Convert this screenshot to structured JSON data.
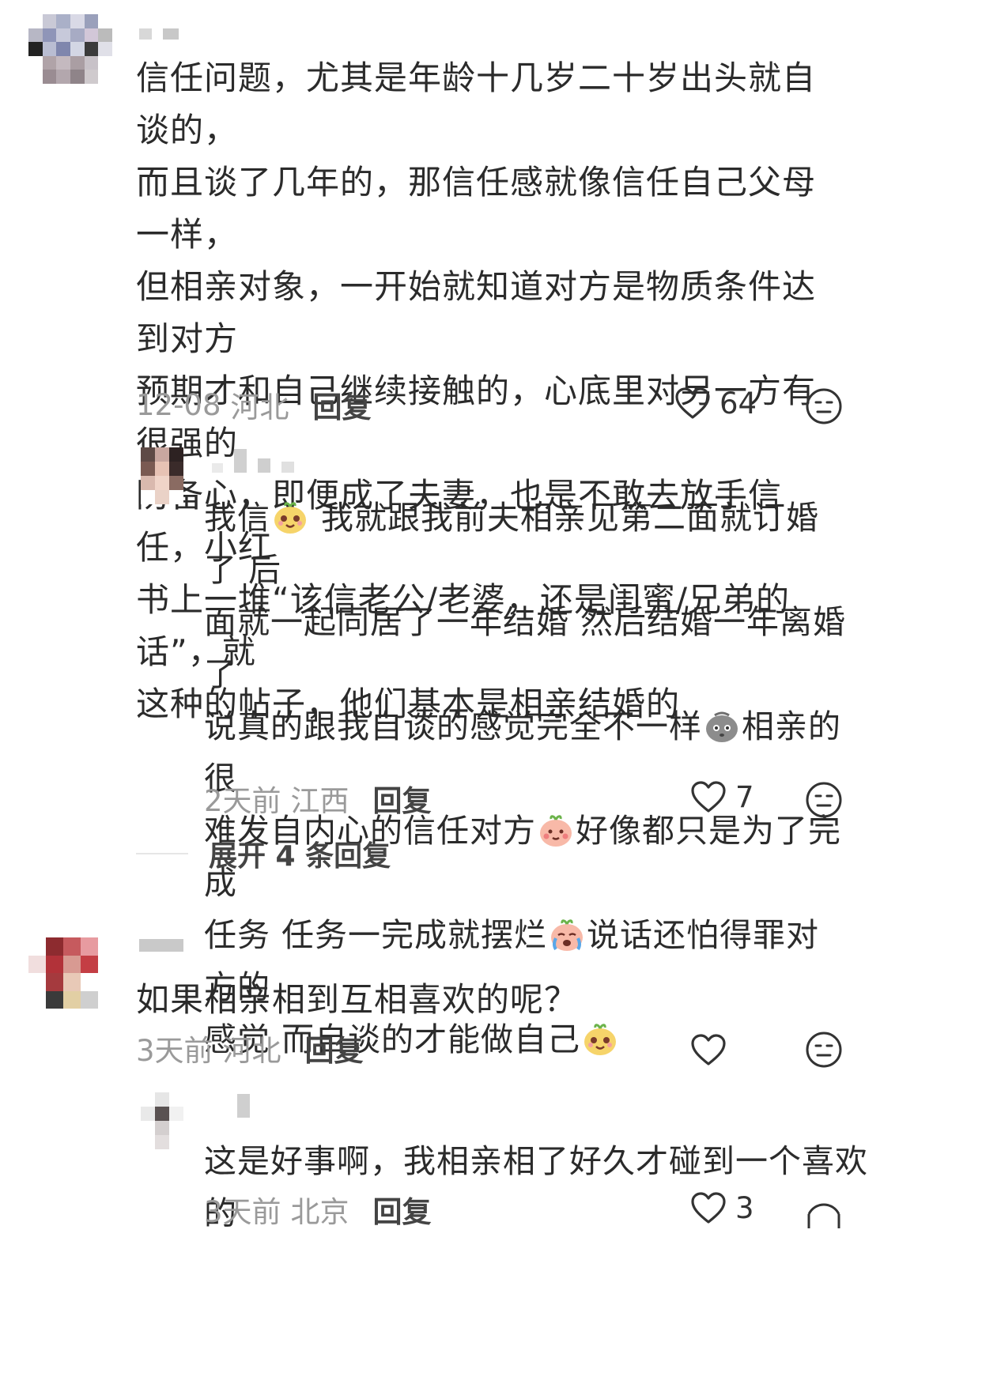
{
  "comments": [
    {
      "text": "信任问题，尤其是年龄十几岁二十岁出头就自谈的，而且谈了几年的，那信任感就像信任自己父母一样，但相亲对象，一开始就知道对方是物质条件达到对方预期才和自己继续接触的，心底里对另一方有很强的防备心，即便成了夫妻，也是不敢去放手信任，小红书上一堆“该信老公/老婆，还是闺蜜/兄弟的话”，就这种的帖子，他们基本是相亲结婚的",
      "lines": [
        "信任问题，尤其是年龄十几岁二十岁出头就自谈的，",
        "而且谈了几年的，那信任感就像信任自己父母一样，",
        "但相亲对象，一开始就知道对方是物质条件达到对方",
        "预期才和自己继续接触的，心底里对另一方有很强的",
        "防备心，即便成了夫妻，也是不敢去放手信任，小红",
        "书上一堆“该信老公/老婆，还是闺蜜/兄弟的话”，就",
        "这种的帖子，他们基本是相亲结婚的"
      ],
      "date": "12-08",
      "location": "河北",
      "reply_label": "回复",
      "likes": "64"
    },
    {
      "reply": true,
      "lines": [
        [
          "我信",
          "[emoji:happy-gourd]",
          " 我就跟我前夫相亲见第二面就订婚了 后"
        ],
        [
          "面就一起同居了一年结婚 然后结婚一年离婚了"
        ],
        [
          "说真的跟我自谈的感觉完全不一样",
          "[emoji:grey-rock]",
          "相亲的很"
        ],
        [
          "难发自内心的信任对方",
          "[emoji:shy-peach]",
          "好像都只是为了完成"
        ],
        [
          "任务 任务一完成就摆烂",
          "[emoji:crying-peach]",
          "说话还怕得罪对方的"
        ],
        [
          "感觉 而自谈的才能做自己",
          "[emoji:happy-gourd]"
        ]
      ],
      "date": "2天前",
      "location": "江西",
      "reply_label": "回复",
      "likes": "7"
    },
    {
      "expand_label": "展开 4 条回复"
    },
    {
      "text": "如果相亲相到互相喜欢的呢？",
      "date": "3天前",
      "location": "河北",
      "reply_label": "回复",
      "likes": ""
    },
    {
      "reply": true,
      "text": "这是好事啊，我相亲相了好久才碰到一个喜欢的",
      "date": "3天前",
      "location": "北京",
      "reply_label": "回复",
      "likes": "3"
    }
  ],
  "icons": {
    "like": "heart-outline-icon",
    "dislike": "neutral-face-icon",
    "avatar": "pixelated-avatar"
  },
  "colors": {
    "text": "#2b2b2b",
    "meta": "#9a9a9a",
    "reply": "#444444",
    "icon": "#333333"
  }
}
